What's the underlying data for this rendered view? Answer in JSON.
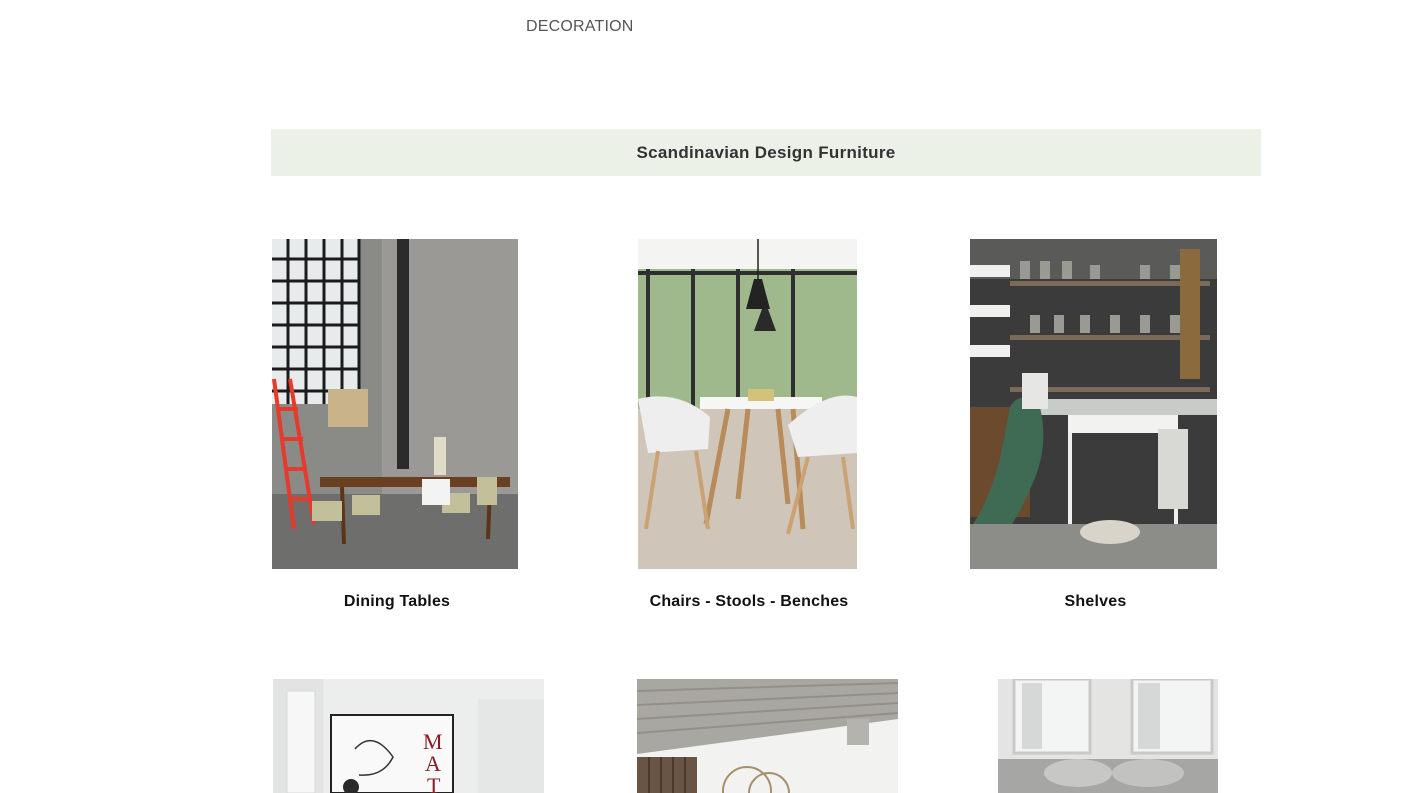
{
  "nav": {
    "decoration_label": "DECORATION"
  },
  "section": {
    "title": "Scandinavian Design Furniture"
  },
  "categories": [
    {
      "label": "Dining Tables",
      "image": "dining-room-photo"
    },
    {
      "label": "Chairs - Stools - Benches",
      "image": "chairs-dining-photo"
    },
    {
      "label": "Shelves",
      "image": "wall-shelves-photo"
    },
    {
      "label": "",
      "image": "poster-wall-photo"
    },
    {
      "label": "",
      "image": "concrete-ceiling-room-photo"
    },
    {
      "label": "",
      "image": "sofa-window-photo"
    }
  ],
  "colors": {
    "banner_bg": "#ebf1e7",
    "text_dark": "#111111",
    "nav_text": "#555555"
  }
}
